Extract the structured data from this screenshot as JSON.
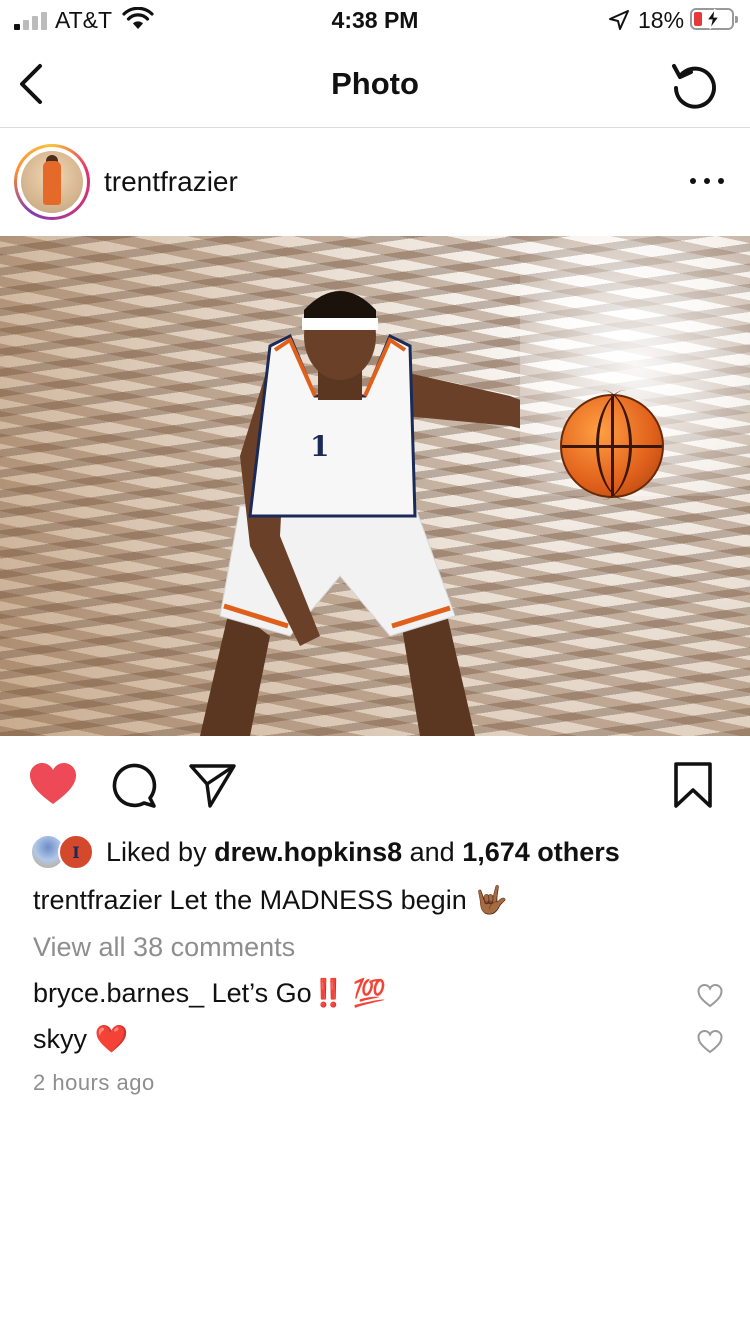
{
  "status_bar": {
    "carrier": "AT&T",
    "time": "4:38 PM",
    "battery_percent": "18%",
    "signal_bars_active": 1,
    "battery_fill_fraction": 0.18,
    "battery_color": "#e5393a"
  },
  "nav": {
    "title": "Photo",
    "back_icon": "chevron-left-icon",
    "refresh_icon": "refresh-icon"
  },
  "post": {
    "username": "trentfrazier",
    "more_icon": "more-horizontal-icon",
    "liked": true,
    "like_color": "#ed4956"
  },
  "likes": {
    "prefix": "Liked by ",
    "first_user": "drew.hopkins8",
    "connector": " and ",
    "others": "1,674 others"
  },
  "caption": {
    "username": "trentfrazier",
    "text": " Let the MADNESS begin 🤟🏾"
  },
  "view_all_comments": "View all 38 comments",
  "comments": [
    {
      "username": "bryce.barnes_",
      "text": " Let’s Go‼️ 💯"
    },
    {
      "username": "skyy",
      "text": " ❤️"
    }
  ],
  "timestamp": "2 hours ago"
}
